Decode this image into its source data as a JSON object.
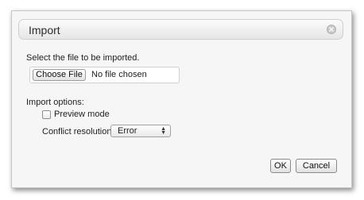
{
  "dialog": {
    "title": "Import",
    "close_icon": "close-icon",
    "prompt": "Select the file to be imported.",
    "file_input": {
      "button_label": "Choose File",
      "status": "No file chosen"
    },
    "options_label": "Import options:",
    "preview_mode": {
      "label": "Preview mode",
      "checked": false
    },
    "conflict": {
      "label": "Conflict resolution:",
      "selected": "Error"
    },
    "buttons": {
      "ok": "OK",
      "cancel": "Cancel"
    }
  }
}
